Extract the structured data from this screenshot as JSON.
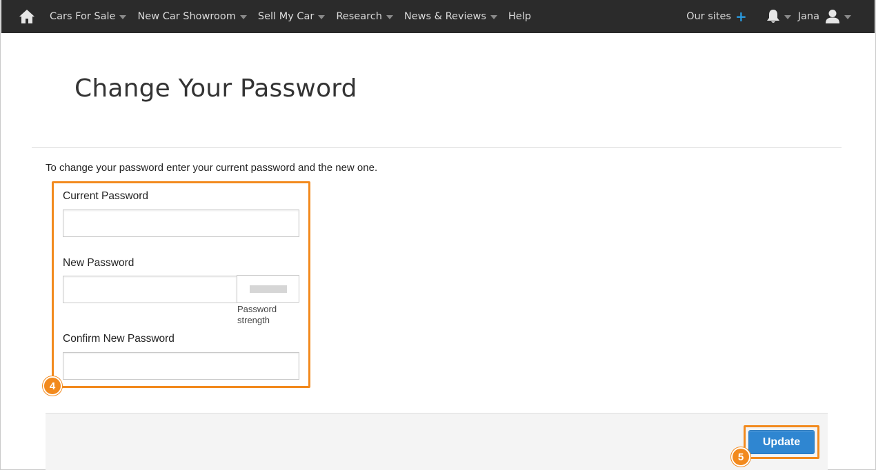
{
  "nav": {
    "home_icon": "home-icon",
    "items": [
      {
        "label": "Cars For Sale",
        "has_caret": true
      },
      {
        "label": "New Car Showroom",
        "has_caret": true
      },
      {
        "label": "Sell My Car",
        "has_caret": true
      },
      {
        "label": "Research",
        "has_caret": true
      },
      {
        "label": "News & Reviews",
        "has_caret": true
      },
      {
        "label": "Help",
        "has_caret": false
      }
    ],
    "our_sites_label": "Our sites",
    "our_sites_icon": "+",
    "bell_icon": "bell-icon",
    "user_name": "Jana",
    "user_icon": "user-icon"
  },
  "page": {
    "title": "Change Your Password",
    "intro": "To change your password enter your current password and the new one."
  },
  "form": {
    "current_password_label": "Current Password",
    "current_password_value": "",
    "new_password_label": "New Password",
    "new_password_value": "",
    "strength_label": "Password strength",
    "confirm_password_label": "Confirm New Password",
    "confirm_password_value": ""
  },
  "actions": {
    "update_label": "Update"
  },
  "callouts": {
    "form_step": "4",
    "button_step": "5"
  },
  "colors": {
    "nav_bg": "#2b2b2b",
    "accent_orange": "#f28a1e",
    "button_blue": "#2f86d1",
    "plus_blue": "#2a9be0"
  }
}
